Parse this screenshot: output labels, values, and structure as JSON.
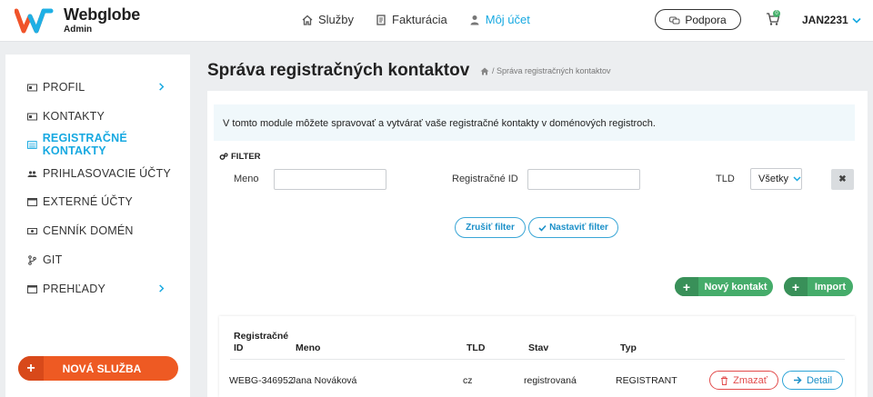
{
  "header": {
    "brand": "Webglobe",
    "brand_sub": "Admin",
    "nav": [
      {
        "label": "Služby",
        "icon": "home-icon"
      },
      {
        "label": "Fakturácia",
        "icon": "invoice-icon"
      },
      {
        "label": "Môj účet",
        "icon": "user-icon"
      }
    ],
    "support_label": "Podpora",
    "cart_count": "0",
    "username": "JAN2231"
  },
  "sidebar": {
    "items": [
      {
        "label": "PROFIL"
      },
      {
        "label": "KONTAKTY"
      },
      {
        "label": "REGISTRAČNÉ KONTAKTY"
      },
      {
        "label": "PRIHLASOVACIE ÚČTY"
      },
      {
        "label": "EXTERNÉ ÚČTY"
      },
      {
        "label": "CENNÍK DOMÉN"
      },
      {
        "label": "GIT"
      },
      {
        "label": "PREHĽADY"
      }
    ],
    "new_service_label": "NOVÁ SLUŽBA"
  },
  "main": {
    "title": "Správa registračných kontaktov",
    "breadcrumb": "/ Správa registračných kontaktov",
    "info_text": "V tomto module môžete spravovať a vytvárať vaše registračné kontakty v doménových registroch.",
    "filter": {
      "title": "FILTER",
      "name_label": "Meno",
      "name_value": "",
      "regid_label": "Registračné ID",
      "regid_value": "",
      "tld_label": "TLD",
      "tld_selected": "Všetky",
      "cancel_label": "Zrušiť filter",
      "apply_label": "Nastaviť filter"
    },
    "new_contact_label": "Nový kontakt",
    "import_label": "Import",
    "table": {
      "headers": [
        "Registračné ID",
        "Meno",
        "TLD",
        "Stav",
        "Typ"
      ],
      "rows": [
        {
          "id": "WEBG-346952",
          "name": "Jana Nováková",
          "tld": "cz",
          "state": "registrovaná",
          "type": "REGISTRANT"
        }
      ],
      "delete_label": "Zmazať",
      "detail_label": "Detail"
    }
  }
}
